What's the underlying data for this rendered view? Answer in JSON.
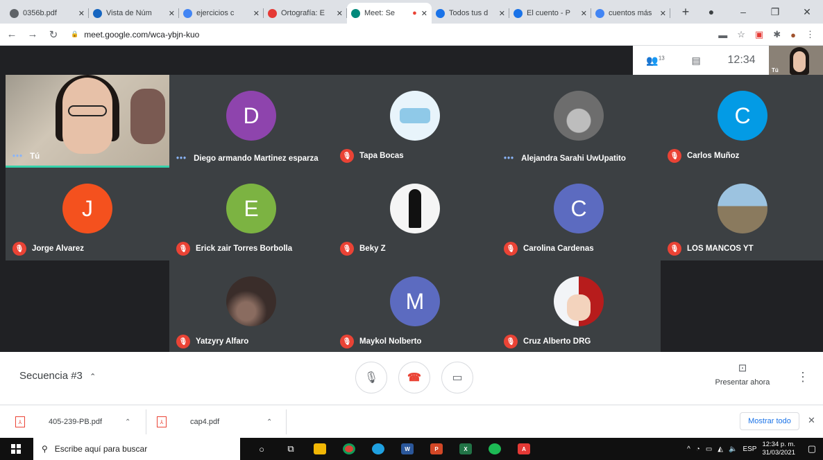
{
  "browser": {
    "tabs": [
      {
        "title": "0356b.pdf",
        "color": "#5f6368",
        "active": false
      },
      {
        "title": "Vista de Núm",
        "color": "#1565c0",
        "active": false
      },
      {
        "title": "ejercicios c",
        "color": "#4285f4",
        "active": false
      },
      {
        "title": "Ortografía: E",
        "color": "#e53935",
        "active": false
      },
      {
        "title": "Meet: Se",
        "color": "#00897b",
        "active": true
      },
      {
        "title": "Todos tus d",
        "color": "#1a73e8",
        "active": false
      },
      {
        "title": "El cuento - P",
        "color": "#1a73e8",
        "active": false
      },
      {
        "title": "cuentos más",
        "color": "#4285f4",
        "active": false
      }
    ],
    "url": "meet.google.com/wca-ybjn-kuo"
  },
  "meet": {
    "participant_count": "13",
    "clock": "12:34",
    "self_label": "Tú",
    "participants": [
      {
        "name": "Tú",
        "initial": "",
        "color": "",
        "status": "dots",
        "type": "self"
      },
      {
        "name": "Diego armando Martinez esparza",
        "initial": "D",
        "color": "#8e44ad",
        "status": "dots",
        "type": "letter"
      },
      {
        "name": "Tapa Bocas",
        "initial": "",
        "color": "#e8f4fb",
        "status": "muted",
        "type": "mask"
      },
      {
        "name": "Alejandra Sarahi UwUpatito",
        "initial": "",
        "color": "#6d6d6d",
        "status": "dots",
        "type": "anime"
      },
      {
        "name": "Carlos Muñoz",
        "initial": "C",
        "color": "#039be5",
        "status": "muted",
        "type": "letter"
      },
      {
        "name": "Jorge Alvarez",
        "initial": "J",
        "color": "#f4511e",
        "status": "muted",
        "type": "letter"
      },
      {
        "name": "Erick zair Torres Borbolla",
        "initial": "E",
        "color": "#7cb342",
        "status": "muted",
        "type": "letter"
      },
      {
        "name": "Beky Z",
        "initial": "",
        "color": "#f5f5f5",
        "status": "muted",
        "type": "silhouette"
      },
      {
        "name": "Carolina Cardenas",
        "initial": "C",
        "color": "#5c6bc0",
        "status": "muted",
        "type": "letter"
      },
      {
        "name": "LOS MANCOS YT",
        "initial": "",
        "color": "#7aa6c2",
        "status": "muted",
        "type": "photo"
      },
      {
        "name": "Yatzyry Alfaro",
        "initial": "",
        "color": "#3a2d2a",
        "status": "muted",
        "type": "dark"
      },
      {
        "name": "Maykol Nolberto",
        "initial": "M",
        "color": "#5c6bc0",
        "status": "muted",
        "type": "letter"
      },
      {
        "name": "Cruz Alberto DRG",
        "initial": "",
        "color": "#dfe6ee",
        "status": "muted",
        "type": "anime2"
      }
    ],
    "meeting_name": "Secuencia #3",
    "present_label": "Presentar ahora"
  },
  "downloads": {
    "items": [
      {
        "name": "405-239-PB.pdf"
      },
      {
        "name": "cap4.pdf"
      }
    ],
    "show_all": "Mostrar todo"
  },
  "taskbar": {
    "search_placeholder": "Escribe aquí para buscar",
    "lang": "ESP",
    "time": "12:34 p. m.",
    "date": "31/03/2021"
  }
}
